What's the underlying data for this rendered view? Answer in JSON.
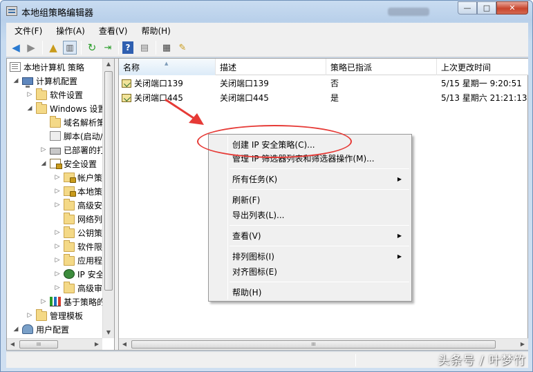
{
  "window": {
    "title": "本地组策略编辑器",
    "controls": {
      "minimize": "—",
      "maximize": "□",
      "close": "✕"
    }
  },
  "menubar": [
    {
      "label": "文件(F)"
    },
    {
      "label": "操作(A)"
    },
    {
      "label": "查看(V)"
    },
    {
      "label": "帮助(H)"
    }
  ],
  "toolbar": {
    "icons": [
      "back-icon",
      "forward-icon",
      "up-folder-icon",
      "show-tree-icon",
      "refresh-icon",
      "export-list-icon",
      "help-icon",
      "console-view-icon",
      "properties-icon",
      "new-policy-icon"
    ]
  },
  "tree": {
    "items": [
      {
        "label": "本地计算机 策略",
        "toggle": ""
      },
      {
        "label": "计算机配置",
        "toggle": "◢"
      },
      {
        "label": "软件设置",
        "toggle": "▷"
      },
      {
        "label": "Windows 设置",
        "toggle": "◢"
      },
      {
        "label": "域名解析策略",
        "toggle": ""
      },
      {
        "label": "脚本(启动/关机)",
        "toggle": ""
      },
      {
        "label": "已部署的打印机",
        "toggle": "▷"
      },
      {
        "label": "安全设置",
        "toggle": "◢"
      },
      {
        "label": "帐户策略",
        "toggle": "▷"
      },
      {
        "label": "本地策略",
        "toggle": "▷"
      },
      {
        "label": "高级安全",
        "toggle": "▷"
      },
      {
        "label": "网络列表",
        "toggle": ""
      },
      {
        "label": "公钥策略",
        "toggle": "▷"
      },
      {
        "label": "软件限制",
        "toggle": "▷"
      },
      {
        "label": "应用程序",
        "toggle": "▷"
      },
      {
        "label": "IP 安全策略",
        "toggle": "▷"
      },
      {
        "label": "高级审核",
        "toggle": "▷"
      },
      {
        "label": "基于策略的",
        "toggle": "▷"
      },
      {
        "label": "管理模板",
        "toggle": "▷"
      },
      {
        "label": "用户配置",
        "toggle": "◢"
      }
    ]
  },
  "list": {
    "columns": [
      "名称",
      "描述",
      "策略已指派",
      "上次更改时间"
    ],
    "rows": [
      {
        "name": "关闭端口139",
        "description": "关闭端口139",
        "assigned": "否",
        "modified": "5/15 星期一 9:20:51"
      },
      {
        "name": "关闭端口445",
        "description": "关闭端口445",
        "assigned": "是",
        "modified": "5/13 星期六 21:21:13"
      }
    ]
  },
  "context_menu": {
    "items": [
      {
        "label": "创建 IP 安全策略(C)...",
        "submenu": ""
      },
      {
        "label": "管理 IP 筛选器列表和筛选器操作(M)...",
        "submenu": ""
      },
      {
        "label": "所有任务(K)",
        "submenu": "▶"
      },
      {
        "label": "刷新(F)",
        "submenu": ""
      },
      {
        "label": "导出列表(L)...",
        "submenu": ""
      },
      {
        "label": "查看(V)",
        "submenu": "▶"
      },
      {
        "label": "排列图标(I)",
        "submenu": "▶"
      },
      {
        "label": "对齐图标(E)",
        "submenu": ""
      },
      {
        "label": "帮助(H)",
        "submenu": ""
      }
    ]
  },
  "scrollbars": {
    "grip": "III"
  },
  "watermark": "头条号 / 叶梦竹",
  "colors": {
    "annotation": "#e63a36",
    "title_gradient": "#c9dcf1"
  }
}
